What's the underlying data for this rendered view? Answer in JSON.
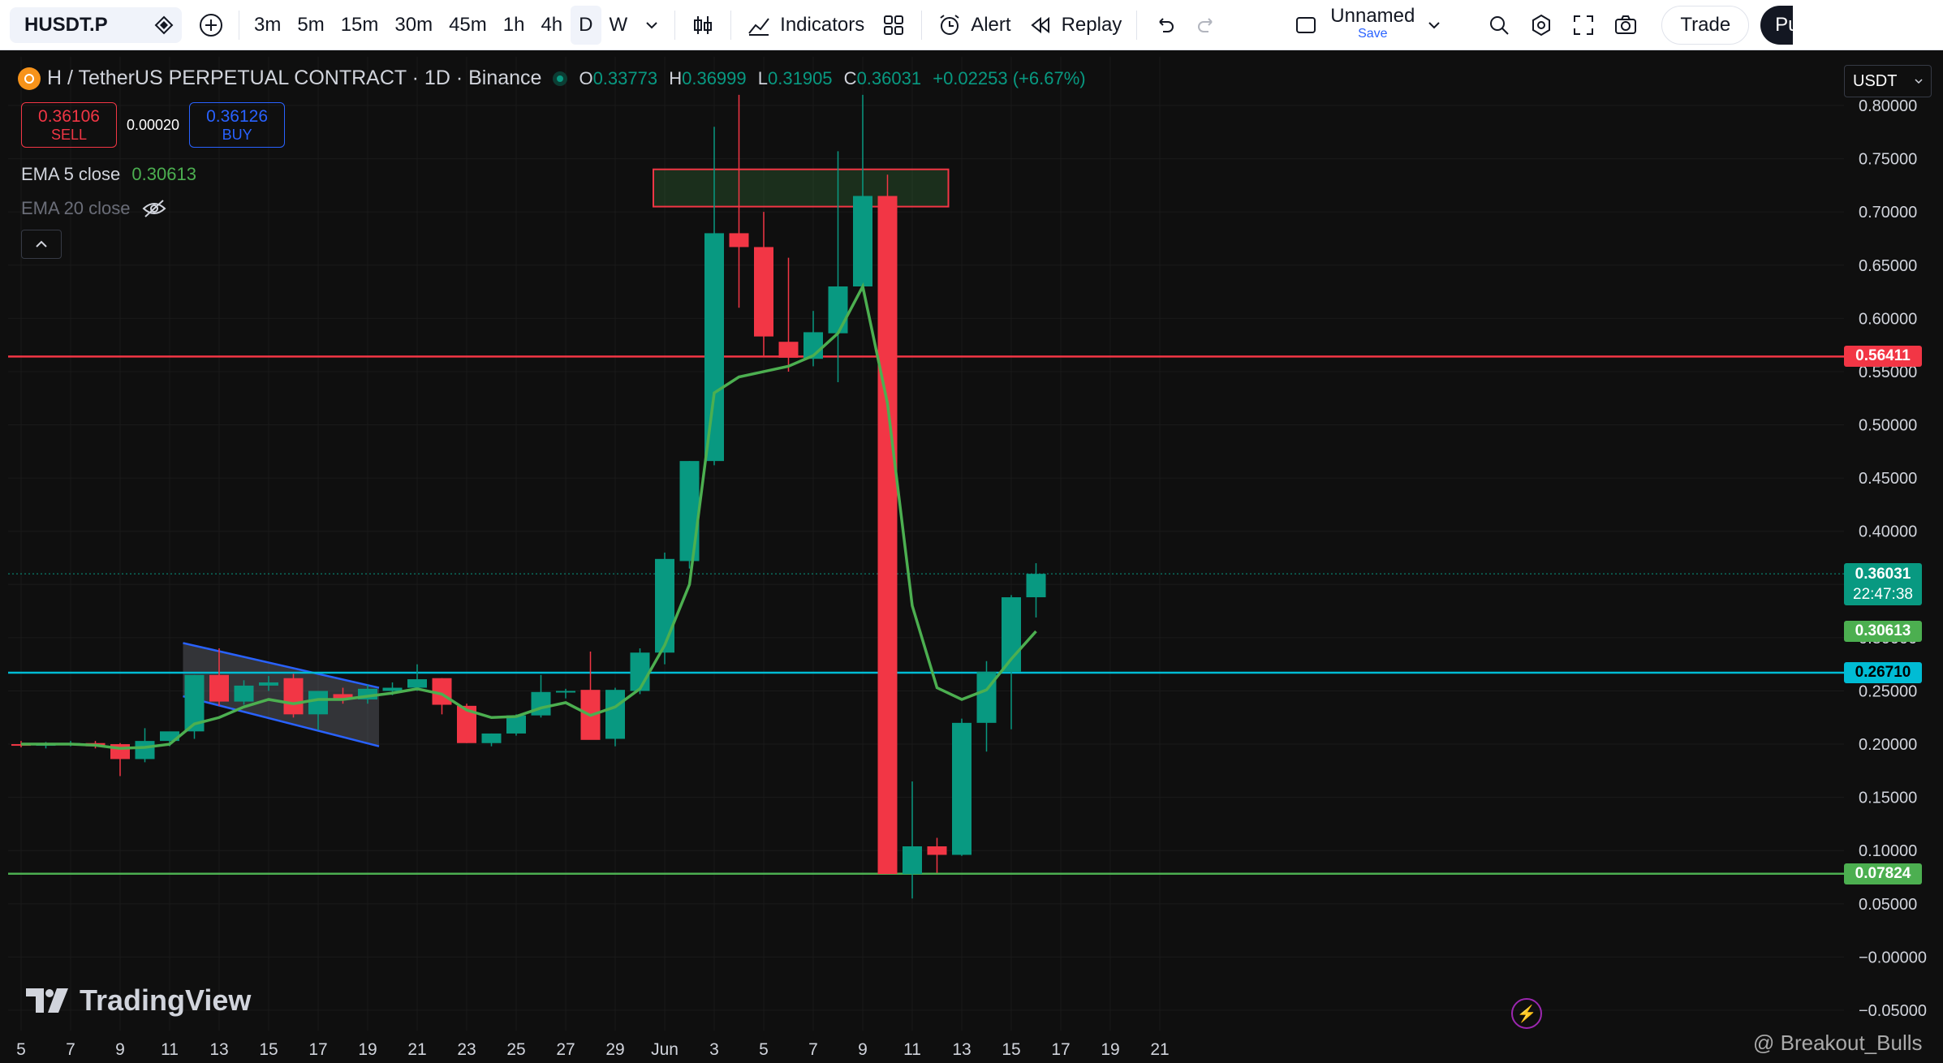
{
  "toolbar": {
    "symbol": "HUSDT.P",
    "intervals": [
      "3m",
      "5m",
      "15m",
      "30m",
      "45m",
      "1h",
      "4h",
      "D",
      "W"
    ],
    "active_interval": "D",
    "indicators_label": "Indicators",
    "alert_label": "Alert",
    "replay_label": "Replay",
    "layout_name": "Unnamed",
    "layout_save": "Save",
    "trade_label": "Trade",
    "publish_label": "Pu"
  },
  "legend": {
    "title": "H / TetherUS PERPETUAL CONTRACT · 1D · Binance",
    "o_label": "O",
    "o": "0.33773",
    "h_label": "H",
    "h": "0.36999",
    "l_label": "L",
    "l": "0.31905",
    "c_label": "C",
    "c": "0.36031",
    "change": "+0.02253 (+6.67%)"
  },
  "trade": {
    "sell_price": "0.36106",
    "sell_label": "SELL",
    "spread": "0.00020",
    "buy_price": "0.36126",
    "buy_label": "BUY"
  },
  "ema5": {
    "label": "EMA 5 close",
    "value": "0.30613"
  },
  "ema20": {
    "label": "EMA 20 close"
  },
  "currency": "USDT",
  "price_labels": {
    "resistance": "0.56411",
    "last_price": "0.36031",
    "countdown": "22:47:38",
    "ema": "0.30613",
    "support_blue": "0.26710",
    "support_green": "0.07824"
  },
  "branding": {
    "logo_text": "TradingView",
    "watermark": "@ Breakout_Bulls"
  },
  "colors": {
    "up": "#089981",
    "down": "#f23645",
    "ema": "#4caf50",
    "blue_line": "#00bcd4",
    "red_line": "#f23645",
    "green_line": "#4caf50"
  },
  "chart_data": {
    "type": "candlestick",
    "title": "H / TetherUS PERPETUAL CONTRACT · 1D · Binance",
    "y_axis_ticks": [
      "0.80000",
      "0.75000",
      "0.70000",
      "0.65000",
      "0.60000",
      "0.55000",
      "0.50000",
      "0.45000",
      "0.40000",
      "0.35000",
      "0.30000",
      "0.25000",
      "0.20000",
      "0.15000",
      "0.10000",
      "0.05000",
      "−0.00000",
      "−0.05000"
    ],
    "ylim": [
      -0.06,
      0.81
    ],
    "x_axis_ticks": [
      "5",
      "7",
      "9",
      "11",
      "13",
      "15",
      "17",
      "19",
      "21",
      "23",
      "25",
      "27",
      "29",
      "Jun",
      "3",
      "5",
      "7",
      "9",
      "11",
      "13",
      "15",
      "17",
      "19",
      "21"
    ],
    "candles": [
      {
        "o": 0.2,
        "h": 0.203,
        "l": 0.197,
        "c": 0.199
      },
      {
        "o": 0.199,
        "h": 0.202,
        "l": 0.196,
        "c": 0.2
      },
      {
        "o": 0.2,
        "h": 0.203,
        "l": 0.198,
        "c": 0.201
      },
      {
        "o": 0.201,
        "h": 0.203,
        "l": 0.196,
        "c": 0.198
      },
      {
        "o": 0.2,
        "h": 0.201,
        "l": 0.17,
        "c": 0.186
      },
      {
        "o": 0.186,
        "h": 0.215,
        "l": 0.183,
        "c": 0.203
      },
      {
        "o": 0.203,
        "h": 0.21,
        "l": 0.198,
        "c": 0.212
      },
      {
        "o": 0.212,
        "h": 0.265,
        "l": 0.205,
        "c": 0.265
      },
      {
        "o": 0.265,
        "h": 0.29,
        "l": 0.236,
        "c": 0.24
      },
      {
        "o": 0.24,
        "h": 0.26,
        "l": 0.237,
        "c": 0.255
      },
      {
        "o": 0.255,
        "h": 0.264,
        "l": 0.25,
        "c": 0.258
      },
      {
        "o": 0.262,
        "h": 0.266,
        "l": 0.225,
        "c": 0.228
      },
      {
        "o": 0.228,
        "h": 0.25,
        "l": 0.213,
        "c": 0.25
      },
      {
        "o": 0.247,
        "h": 0.253,
        "l": 0.238,
        "c": 0.242
      },
      {
        "o": 0.242,
        "h": 0.256,
        "l": 0.238,
        "c": 0.252
      },
      {
        "o": 0.25,
        "h": 0.258,
        "l": 0.246,
        "c": 0.253
      },
      {
        "o": 0.253,
        "h": 0.275,
        "l": 0.25,
        "c": 0.261
      },
      {
        "o": 0.262,
        "h": 0.262,
        "l": 0.228,
        "c": 0.237
      },
      {
        "o": 0.236,
        "h": 0.238,
        "l": 0.201,
        "c": 0.201
      },
      {
        "o": 0.201,
        "h": 0.21,
        "l": 0.198,
        "c": 0.21
      },
      {
        "o": 0.21,
        "h": 0.228,
        "l": 0.208,
        "c": 0.227
      },
      {
        "o": 0.227,
        "h": 0.265,
        "l": 0.225,
        "c": 0.249
      },
      {
        "o": 0.249,
        "h": 0.252,
        "l": 0.243,
        "c": 0.25
      },
      {
        "o": 0.251,
        "h": 0.287,
        "l": 0.206,
        "c": 0.204
      },
      {
        "o": 0.205,
        "h": 0.253,
        "l": 0.198,
        "c": 0.251
      },
      {
        "o": 0.25,
        "h": 0.29,
        "l": 0.247,
        "c": 0.286
      },
      {
        "o": 0.286,
        "h": 0.38,
        "l": 0.275,
        "c": 0.374
      },
      {
        "o": 0.372,
        "h": 0.466,
        "l": 0.365,
        "c": 0.466
      },
      {
        "o": 0.466,
        "h": 0.78,
        "l": 0.462,
        "c": 0.68
      },
      {
        "o": 0.68,
        "h": 0.81,
        "l": 0.61,
        "c": 0.667
      },
      {
        "o": 0.667,
        "h": 0.7,
        "l": 0.565,
        "c": 0.583
      },
      {
        "o": 0.578,
        "h": 0.657,
        "l": 0.55,
        "c": 0.563
      },
      {
        "o": 0.562,
        "h": 0.607,
        "l": 0.555,
        "c": 0.587
      },
      {
        "o": 0.586,
        "h": 0.757,
        "l": 0.54,
        "c": 0.63
      },
      {
        "o": 0.63,
        "h": 0.81,
        "l": 0.625,
        "c": 0.715
      },
      {
        "o": 0.715,
        "h": 0.735,
        "l": 0.078,
        "c": 0.078
      },
      {
        "o": 0.078,
        "h": 0.165,
        "l": 0.055,
        "c": 0.104
      },
      {
        "o": 0.104,
        "h": 0.112,
        "l": 0.079,
        "c": 0.096
      },
      {
        "o": 0.096,
        "h": 0.224,
        "l": 0.095,
        "c": 0.22
      },
      {
        "o": 0.22,
        "h": 0.278,
        "l": 0.193,
        "c": 0.268
      },
      {
        "o": 0.268,
        "h": 0.34,
        "l": 0.214,
        "c": 0.338
      },
      {
        "o": 0.338,
        "h": 0.37,
        "l": 0.319,
        "c": 0.36
      }
    ],
    "ema5": [
      0.2,
      0.2,
      0.2,
      0.199,
      0.196,
      0.197,
      0.2,
      0.219,
      0.225,
      0.235,
      0.242,
      0.238,
      0.242,
      0.242,
      0.245,
      0.248,
      0.252,
      0.247,
      0.232,
      0.225,
      0.226,
      0.234,
      0.239,
      0.227,
      0.235,
      0.252,
      0.293,
      0.35,
      0.53,
      0.545,
      0.55,
      0.555,
      0.565,
      0.586,
      0.63,
      0.52,
      0.33,
      0.253,
      0.242,
      0.251,
      0.28,
      0.306
    ],
    "horizontal_lines": [
      {
        "price": 0.56411,
        "color": "red"
      },
      {
        "price": 0.2671,
        "color": "cyan"
      },
      {
        "price": 0.07824,
        "color": "green"
      }
    ],
    "zones": [
      {
        "type": "rectangle",
        "from_index": 26,
        "to_index": 37,
        "price_top": 0.74,
        "price_bottom": 0.705
      }
    ],
    "channel": {
      "from_index": 7,
      "to_index": 14,
      "upper": [
        0.295,
        0.253
      ],
      "lower": [
        0.245,
        0.198
      ]
    }
  }
}
